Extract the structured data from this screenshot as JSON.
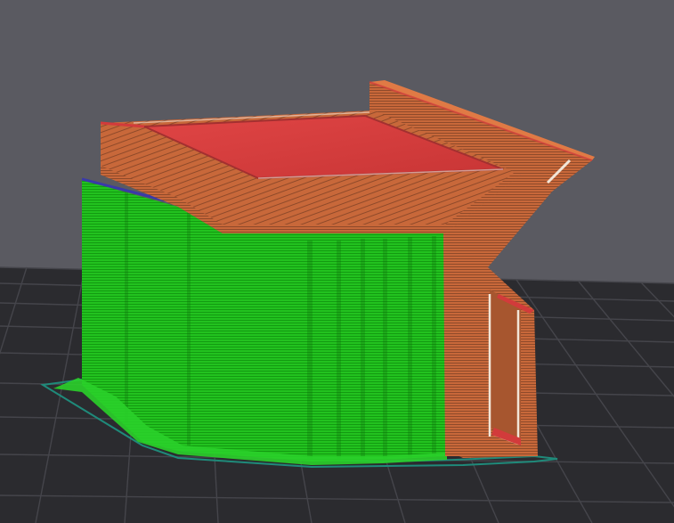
{
  "viewer": {
    "background": "#5a5a61",
    "bed_color": "#2b2b2f",
    "bed_grid_color": "#46464c",
    "skirt_color": "#1f8a7a"
  },
  "colors": {
    "perimeter": "#c8683a",
    "perimeter_dark": "#9a4f2c",
    "top_solid_infill": "#d23b3b",
    "support_material": "#22c21f",
    "support_material_dark": "#16a014",
    "bridge": "#3a3aa8",
    "highlight": "#f2e6d8"
  }
}
